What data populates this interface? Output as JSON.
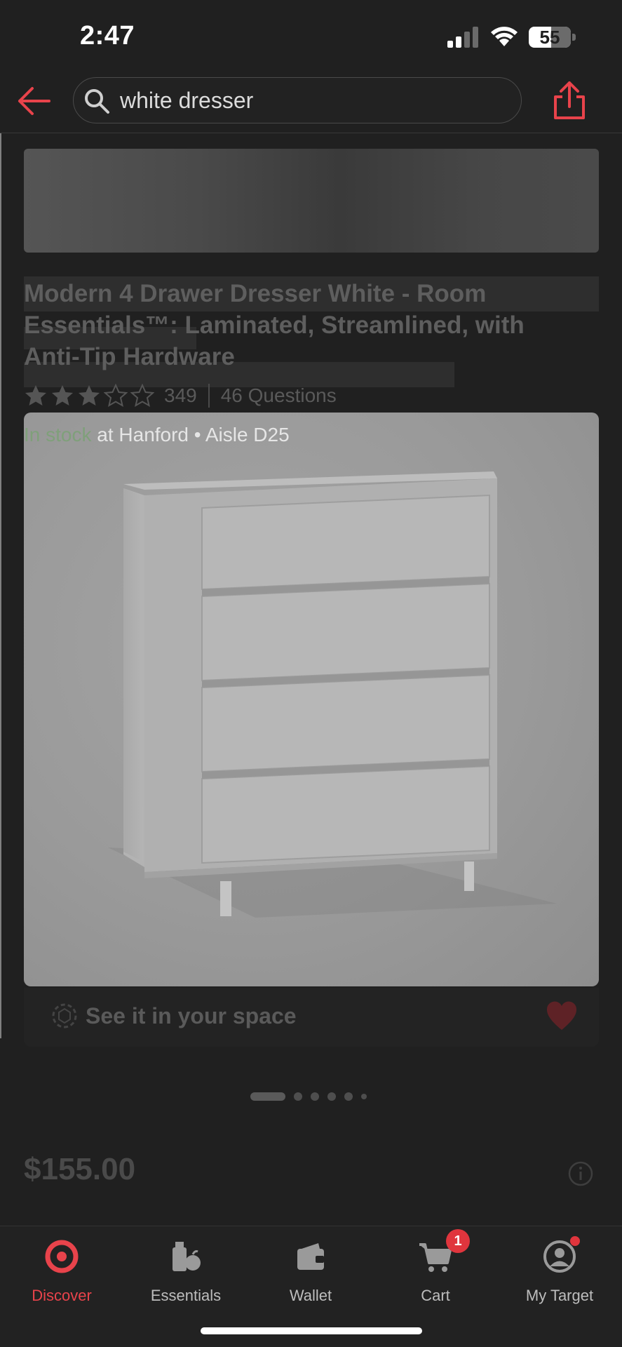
{
  "status_bar": {
    "time": "2:47",
    "battery_level": "55"
  },
  "search": {
    "query": "white dresser"
  },
  "product": {
    "title": "Modern 4 Drawer Dresser White - Room Essentials™: Laminated, Streamlined, with Anti-Tip Hardware",
    "rating_stars": 3,
    "rating_max": 5,
    "rating_count": "349",
    "questions": "46 Questions",
    "stock_status": "In stock",
    "stock_location": " at Hanford • Aisle D25",
    "ar_label": "See it in your space",
    "price": "$155.00"
  },
  "carousel": {
    "active_index": 0,
    "count": 6
  },
  "tabs": [
    {
      "label": "Discover",
      "icon": "target-bullseye-icon",
      "active": true
    },
    {
      "label": "Essentials",
      "icon": "essentials-icon",
      "active": false
    },
    {
      "label": "Wallet",
      "icon": "wallet-icon",
      "active": false
    },
    {
      "label": "Cart",
      "icon": "cart-icon",
      "active": false,
      "badge": "1"
    },
    {
      "label": "My Target",
      "icon": "account-icon",
      "active": false
    }
  ],
  "colors": {
    "accent": "#e8434b",
    "background": "#202020",
    "stock_green": "#7fa07a",
    "badge": "#e0353d"
  }
}
